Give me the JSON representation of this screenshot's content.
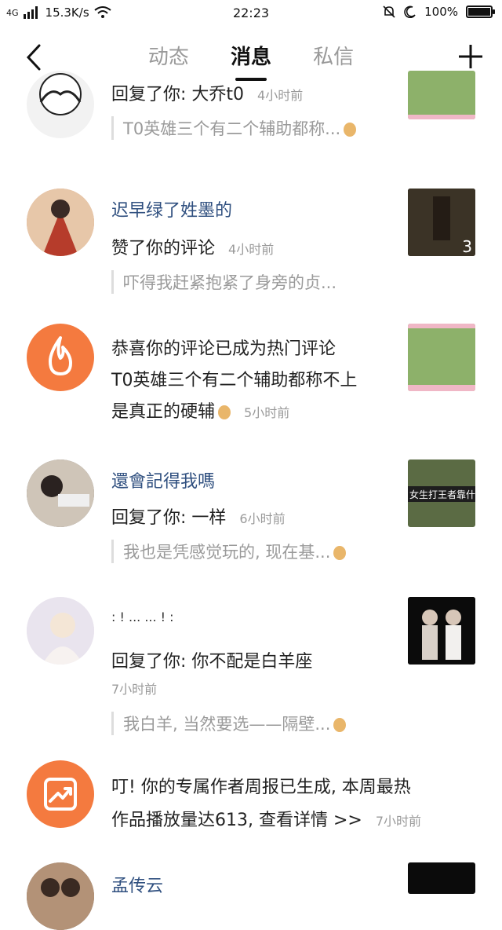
{
  "status_bar": {
    "network": "4G",
    "speed": "15.3K/s",
    "time": "22:23",
    "battery": "100%"
  },
  "nav": {
    "tabs": [
      "动态",
      "消息",
      "私信"
    ],
    "active_tab": "消息"
  },
  "items": [
    {
      "avatar": "sketch-avatar",
      "line1": "回复了你: 大乔t0",
      "time1": "4小时前",
      "quote": "T0英雄三个有二个辅助都称...",
      "thumb": "game-screenshot"
    },
    {
      "name": "迟早绿了姓墨的",
      "line2": "赞了你的评论",
      "time2": "4小时前",
      "quote": "吓得我赶紧抱紧了身旁的贞...",
      "thumb_count": "3",
      "thumb": "game-cover"
    },
    {
      "avatar": "hot-icon",
      "line1": "恭喜你的评论已成为热门评论",
      "line2": "T0英雄三个有二个辅助都称不上",
      "line3": "是真正的硬辅",
      "time3": "5小时前",
      "thumb": "game-screenshot"
    },
    {
      "name": "還會記得我嗎",
      "line2": "回复了你: 一样",
      "time2": "6小时前",
      "quote": "我也是凭感觉玩的, 现在基...",
      "thumb": "game-screenshot",
      "thumb_text": "女生打王者靠什"
    },
    {
      "name": ": !   ... ...   !   :",
      "line2": "回复了你: 你不配是白羊座",
      "time3": "7小时前",
      "quote": "我白羊, 当然要选——隔壁...",
      "thumb": "photo"
    },
    {
      "avatar": "report-icon",
      "line1": "叮! 你的专属作者周报已生成, 本周最热",
      "line2": "作品播放量达613, 查看详情 >>",
      "time2": "7小时前"
    },
    {
      "name": "孟传云",
      "thumb": "photo"
    }
  ]
}
